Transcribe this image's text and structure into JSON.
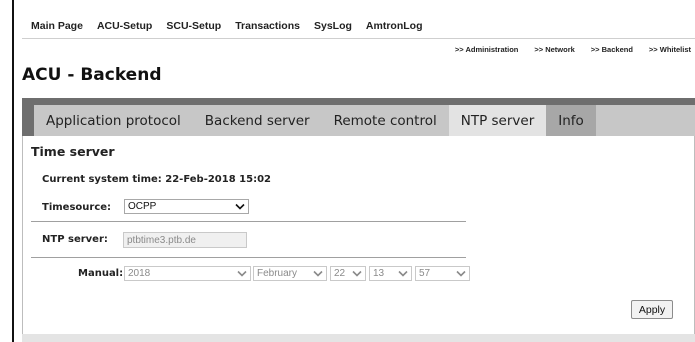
{
  "topnav": {
    "items": [
      "Main Page",
      "ACU-Setup",
      "SCU-Setup",
      "Transactions",
      "SysLog",
      "AmtronLog"
    ]
  },
  "subnav": {
    "items": [
      ">> Administration",
      ">> Network",
      ">> Backend",
      ">> Whitelist"
    ]
  },
  "page_title": "ACU - Backend",
  "tabs": [
    {
      "label": "Application protocol",
      "active": false
    },
    {
      "label": "Backend server",
      "active": false
    },
    {
      "label": "Remote control",
      "active": false
    },
    {
      "label": "NTP server",
      "active": true
    },
    {
      "label": "Info",
      "active": false
    }
  ],
  "section_title": "Time server",
  "system_time": "Current system time: 22-Feb-2018 15:02",
  "timesource": {
    "label": "Timesource:",
    "value": "OCPP"
  },
  "ntp": {
    "label": "NTP server:",
    "value": "ptbtime3.ptb.de"
  },
  "manual": {
    "label": "Manual:",
    "year": "2018",
    "month": "February",
    "day": "22",
    "hour": "13",
    "minute": "57"
  },
  "apply_label": "Apply",
  "icons": {
    "dropdown": "chevron-down-icon"
  },
  "colors": {
    "tabbar": "#6e6e6e",
    "tab_strip": "#c7c7c7",
    "tab_active": "#e3e3e3"
  }
}
